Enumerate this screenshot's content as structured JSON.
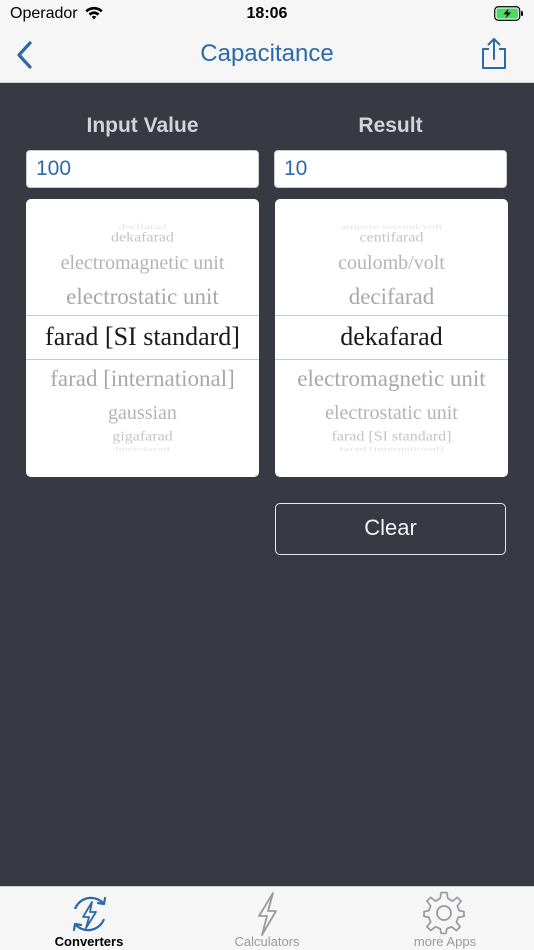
{
  "status_bar": {
    "carrier": "Operador",
    "time": "18:06"
  },
  "nav": {
    "title": "Capacitance"
  },
  "converter": {
    "input_label": "Input Value",
    "result_label": "Result",
    "input_value": "100",
    "result_value": "10",
    "clear_label": "Clear"
  },
  "picker_from": {
    "items_above": [
      "decifarad",
      "dekafarad",
      "electromagnetic unit",
      "electrostatic unit"
    ],
    "selected": "farad [SI standard]",
    "items_below": [
      "farad [international]",
      "gaussian",
      "gigafarad",
      "hectofarad"
    ]
  },
  "picker_to": {
    "items_above": [
      "ampere second/volt",
      "centifarad",
      "coulomb/volt",
      "decifarad"
    ],
    "selected": "dekafarad",
    "items_below": [
      "electromagnetic unit",
      "electrostatic unit",
      "farad [SI standard]",
      "farad [international]"
    ]
  },
  "tabs": [
    {
      "label": "Converters",
      "icon": "lightning-cycle-icon",
      "active": true
    },
    {
      "label": "Calculators",
      "icon": "lightning-bolt-icon",
      "active": false
    },
    {
      "label": "more Apps",
      "icon": "gear-icon",
      "active": false
    }
  ],
  "colors": {
    "accent": "#2c6aa7",
    "background": "#373a43",
    "bar": "#f6f6f7"
  }
}
